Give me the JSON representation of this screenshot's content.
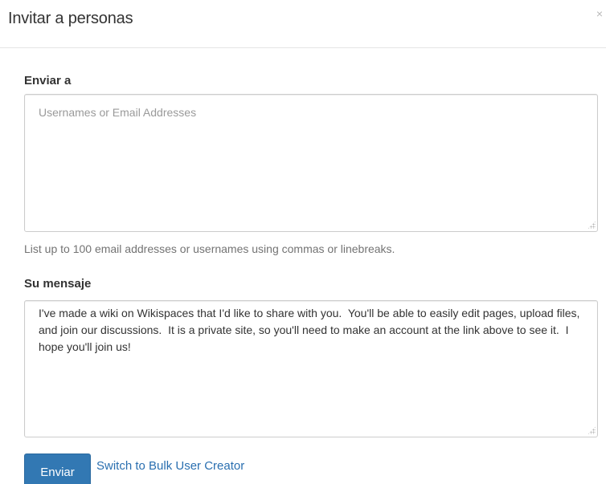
{
  "dialog": {
    "title": "Invitar a personas",
    "close_icon": "×"
  },
  "form": {
    "to_label": "Enviar a",
    "to_placeholder": "Usernames or Email Addresses",
    "to_help": "List up to 100 email addresses or usernames using commas or linebreaks.",
    "message_label": "Su mensaje",
    "message_value": "I've made a wiki on Wikispaces that I'd like to share with you.  You'll be able to easily edit pages, upload files, and join our discussions.  It is a private site, so you'll need to make an account at the link above to see it.  I hope you'll join us!"
  },
  "actions": {
    "submit_label": "Enviar",
    "bulk_link_label": "Switch to Bulk User Creator"
  },
  "colors": {
    "primary": "#3278b3",
    "link": "#2a6fb0",
    "help_text": "#737373"
  }
}
